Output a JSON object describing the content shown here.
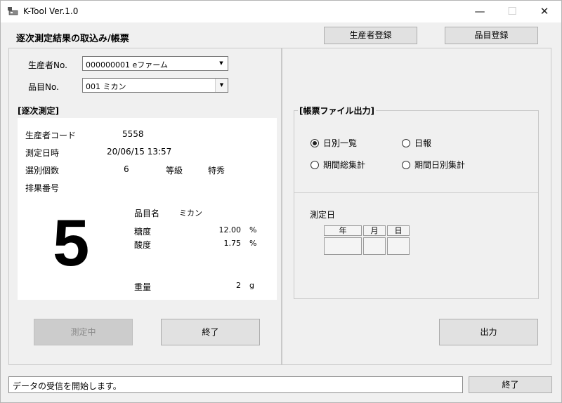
{
  "window": {
    "title": "K-Tool Ver.1.0",
    "minimize": "—",
    "maximize": "☐",
    "close": "✕"
  },
  "header": {
    "title": "逐次測定結果の取込み/帳票",
    "producer_register_button": "生産者登録",
    "item_register_button": "品目登録"
  },
  "selectors": {
    "producer_label": "生産者No.",
    "producer_value": "000000001 eファーム",
    "item_label": "品目No.",
    "item_value": "001 ミカン"
  },
  "measurement": {
    "group_title": "[逐次測定]",
    "producer_code_label": "生産者コード",
    "producer_code_value": "5558",
    "datetime_label": "測定日時",
    "datetime_value": "20/06/15 13:57",
    "count_label": "選別個数",
    "count_value": "6",
    "grade_label": "等級",
    "grade_value": "特秀",
    "seq_label": "排果番号",
    "seq_value": "5",
    "item_name_label": "品目名",
    "item_name_value": "ミカン",
    "sugar_label": "糖度",
    "sugar_value": "12.00",
    "sugar_unit": "%",
    "acid_label": "酸度",
    "acid_value": "1.75",
    "acid_unit": "%",
    "weight_label": "重量",
    "weight_value": "2",
    "weight_unit": "g"
  },
  "left_buttons": {
    "measuring": "測定中",
    "end": "終了"
  },
  "report": {
    "group_title": "[帳票ファイル出力]",
    "options": [
      {
        "label": "日別一覧",
        "selected": true
      },
      {
        "label": "日報",
        "selected": false
      },
      {
        "label": "期間総集計",
        "selected": false
      },
      {
        "label": "期間日別集計",
        "selected": false
      }
    ],
    "date_label": "測定日",
    "date_headers": [
      "年",
      "月",
      "日"
    ],
    "output_button": "出力"
  },
  "status_bar": {
    "message": "データの受信を開始します。",
    "end_button": "終了"
  }
}
